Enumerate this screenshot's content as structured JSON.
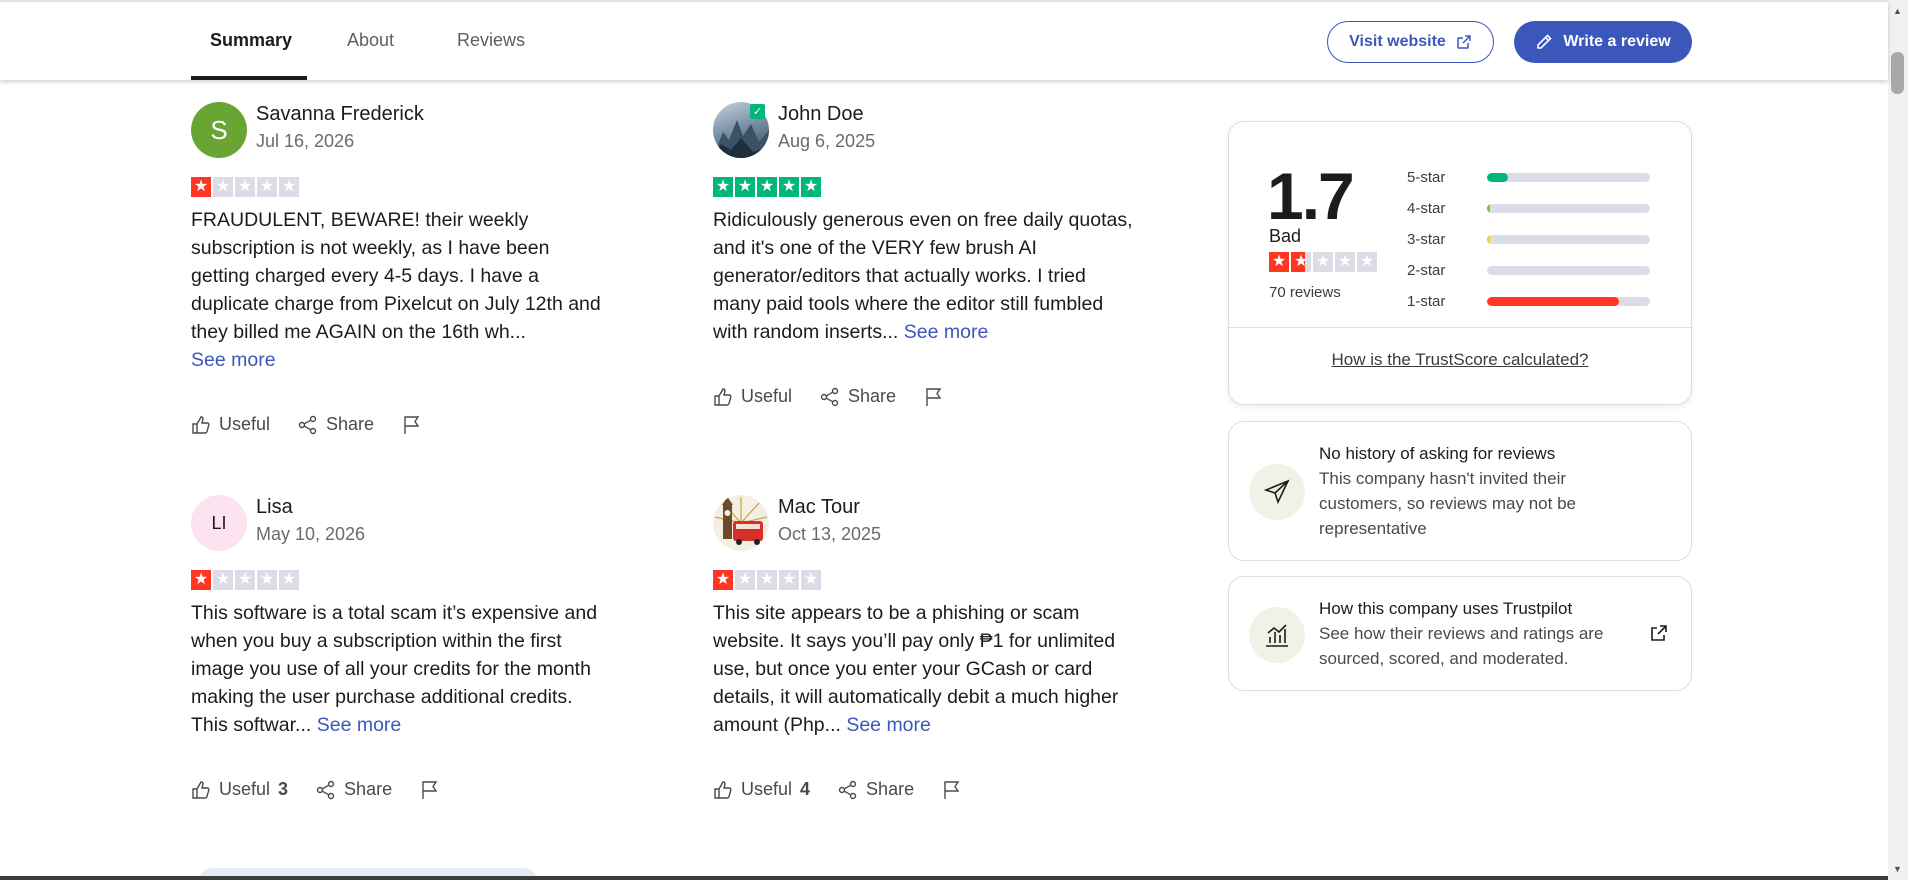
{
  "nav": {
    "tabs": [
      "Summary",
      "About",
      "Reviews"
    ],
    "active_tab": "Summary",
    "visit_label": "Visit website",
    "write_label": "Write a review"
  },
  "reviews": [
    {
      "name": "Savanna Frederick",
      "initials": "S",
      "date": "Jul 16, 2026",
      "rating": 1,
      "text": "FRAUDULENT, BEWARE! their weekly subscription is not weekly, as I have been getting charged every 4-5 days. I have a duplicate charge from Pixelcut on July 12th and they billed me AGAIN on the 16th wh...",
      "see_more": "See more",
      "useful_label": "Useful",
      "useful_count": "",
      "share_label": "Share"
    },
    {
      "name": "John Doe",
      "initials": "",
      "date": "Aug 6, 2025",
      "rating": 5,
      "text": "Ridiculously generous even on free daily quotas, and it's one of the VERY few brush AI generator/editors that actually works. I tried many paid tools where the editor still fumbled with random inserts...",
      "see_more": "See more",
      "useful_label": "Useful",
      "useful_count": "",
      "share_label": "Share"
    },
    {
      "name": "Lisa",
      "initials": "LI",
      "date": "May 10, 2026",
      "rating": 1,
      "text": "This software is a total scam it’s expensive and when you buy a subscription within the first image you use of all your credits for the month making the user purchase additional credits. This softwar...",
      "see_more": "See more",
      "useful_label": "Useful",
      "useful_count": "3",
      "share_label": "Share"
    },
    {
      "name": "Mac Tour",
      "initials": "",
      "date": "Oct 13, 2025",
      "rating": 1,
      "text": "This site appears to be a phishing or scam website. It says you’ll pay only ₱1 for unlimited use, but once you enter your GCash or card details, it will automatically debit a much higher amount (Php...",
      "see_more": "See more",
      "useful_label": "Useful",
      "useful_count": "4",
      "share_label": "Share"
    }
  ],
  "trustscore": {
    "score": "1.7",
    "label": "Bad",
    "stars_value": 1.7,
    "review_count": "70 reviews",
    "distribution": [
      {
        "label": "5-star",
        "fraction": 0.13,
        "color": "#00b67a"
      },
      {
        "label": "4-star",
        "fraction": 0.02,
        "color": "#73cf11"
      },
      {
        "label": "3-star",
        "fraction": 0.02,
        "color": "#ffce00"
      },
      {
        "label": "2-star",
        "fraction": 0.0,
        "color": "#ff8622"
      },
      {
        "label": "1-star",
        "fraction": 0.81,
        "color": "#ff3722"
      }
    ],
    "link": "How is the TrustScore calculated?"
  },
  "info_cards": [
    {
      "icon": "paper-plane-icon",
      "title": "No history of asking for reviews",
      "text": "This company hasn't invited their customers, so reviews may not be representative"
    },
    {
      "icon": "bar-chart-icon",
      "title": "How this company uses Trustpilot",
      "text": "See how their reviews and ratings are sourced, scored, and moderated."
    }
  ],
  "colors": {
    "accent": "#3c57bc",
    "star_red": "#ff3722",
    "star_green": "#00b67a",
    "avatar_green": "#69a533",
    "avatar_pink": "#fde3ef"
  }
}
